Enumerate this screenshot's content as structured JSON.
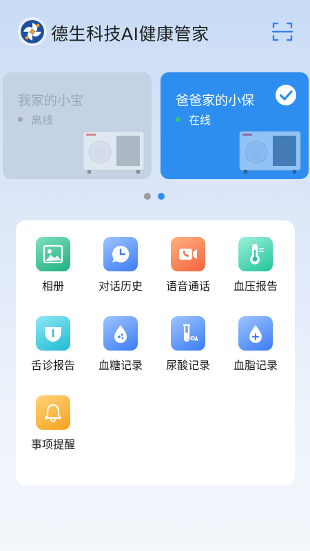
{
  "header": {
    "title": "德生科技AI健康管家",
    "logo_icon": "company-logo-icon",
    "scan_icon": "scan-icon"
  },
  "devices": [
    {
      "name": "我家的小宝",
      "status": "离线",
      "selected": false,
      "status_color": "#9ea8b3"
    },
    {
      "name": "爸爸家的小保",
      "status": "在线",
      "selected": true,
      "status_color": "#3ec26a"
    }
  ],
  "carousel": {
    "page_count": 2,
    "active_index": 2
  },
  "menu": [
    {
      "label": "相册",
      "icon": "photo-album-icon"
    },
    {
      "label": "对话历史",
      "icon": "clock-history-icon"
    },
    {
      "label": "语音通话",
      "icon": "video-call-icon"
    },
    {
      "label": "血压报告",
      "icon": "thermometer-icon"
    },
    {
      "label": "舌诊报告",
      "icon": "tongue-icon"
    },
    {
      "label": "血糖记录",
      "icon": "blood-drop-icon"
    },
    {
      "label": "尿酸记录",
      "icon": "test-tube-icon"
    },
    {
      "label": "血脂记录",
      "icon": "lipid-drop-icon"
    },
    {
      "label": "事项提醒",
      "icon": "bell-icon"
    }
  ],
  "colors": {
    "accent": "#2d8ef0",
    "online": "#3ec26a",
    "offline": "#9ea8b3"
  }
}
